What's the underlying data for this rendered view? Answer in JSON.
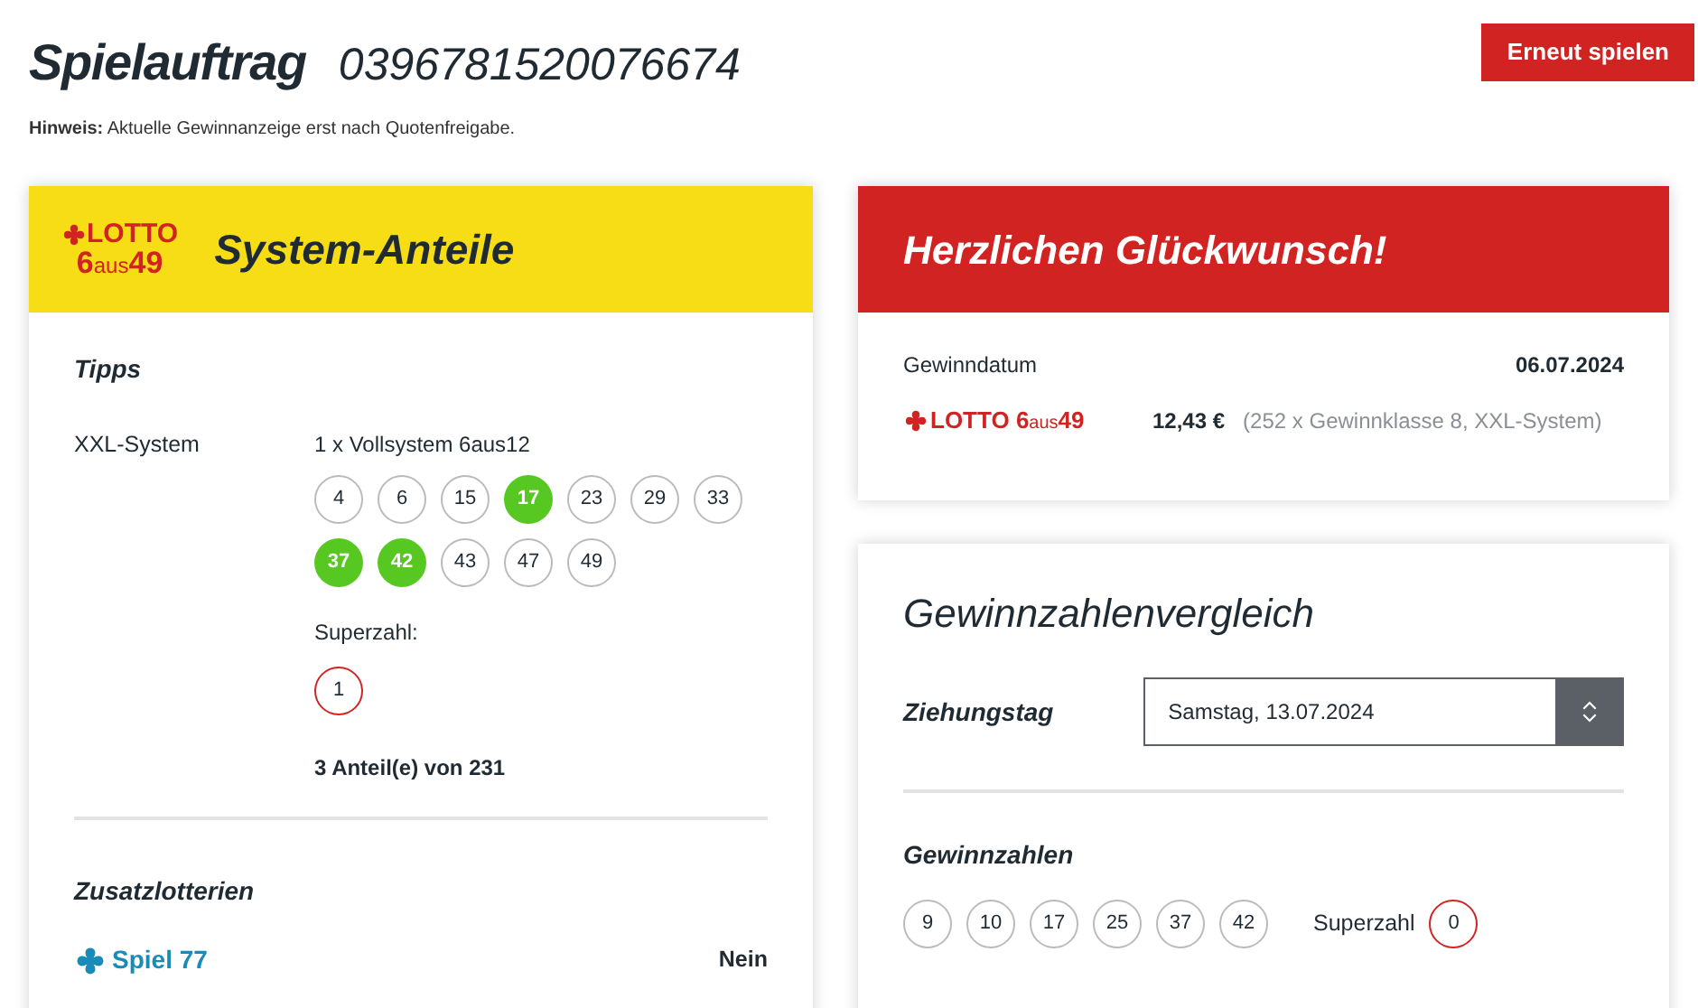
{
  "header": {
    "title": "Spielauftrag",
    "order_number": "0396781520076674",
    "button": "Erneut spielen",
    "hint_label": "Hinweis:",
    "hint_text": "Aktuelle Gewinnanzeige erst nach Quotenfreigabe."
  },
  "system_card": {
    "logo": {
      "top": "LOTTO",
      "six": "6",
      "aus": "aus",
      "num": "49"
    },
    "title": "System-Anteile",
    "tips_heading": "Tipps",
    "system_label": "XXL-System",
    "system_desc": "1 x Vollsystem 6aus12",
    "numbers": [
      {
        "value": "4",
        "matched": false
      },
      {
        "value": "6",
        "matched": false
      },
      {
        "value": "15",
        "matched": false
      },
      {
        "value": "17",
        "matched": true
      },
      {
        "value": "23",
        "matched": false
      },
      {
        "value": "29",
        "matched": false
      },
      {
        "value": "33",
        "matched": false
      },
      {
        "value": "37",
        "matched": true
      },
      {
        "value": "42",
        "matched": true
      },
      {
        "value": "43",
        "matched": false
      },
      {
        "value": "47",
        "matched": false
      },
      {
        "value": "49",
        "matched": false
      }
    ],
    "superzahl_label": "Superzahl:",
    "superzahl": "1",
    "shares": "3 Anteil(e) von 231",
    "extra_heading": "Zusatzlotterien",
    "extras": [
      {
        "name": "Spiel 77",
        "value": "Nein"
      }
    ]
  },
  "win_card": {
    "title": "Herzlichen Glückwunsch!",
    "date_label": "Gewinndatum",
    "date": "06.07.2024",
    "logo": {
      "top": "LOTTO",
      "six": "6",
      "aus": "aus",
      "num": "49"
    },
    "amount": "12,43 €",
    "detail": "(252 x Gewinnklasse 8, XXL-System)"
  },
  "compare_card": {
    "title": "Gewinnzahlenvergleich",
    "day_label": "Ziehungstag",
    "day_value": "Samstag, 13.07.2024",
    "numbers_heading": "Gewinnzahlen",
    "numbers": [
      "9",
      "10",
      "17",
      "25",
      "37",
      "42"
    ],
    "superzahl_label": "Superzahl",
    "superzahl": "0"
  }
}
